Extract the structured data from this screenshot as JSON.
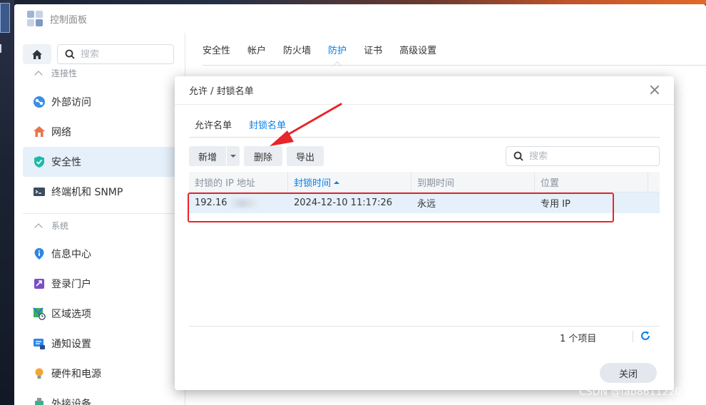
{
  "window": {
    "title": "控制面板"
  },
  "sidebar": {
    "search_placeholder": "搜索",
    "group_connectivity": "连接性",
    "group_system": "系统",
    "items": [
      {
        "label": "外部访问",
        "icon": "external-access-icon"
      },
      {
        "label": "网络",
        "icon": "network-icon"
      },
      {
        "label": "安全性",
        "icon": "security-shield-icon",
        "active": true
      },
      {
        "label": "终端机和 SNMP",
        "icon": "terminal-icon"
      },
      {
        "label": "信息中心",
        "icon": "info-center-icon"
      },
      {
        "label": "登录门户",
        "icon": "login-portal-icon"
      },
      {
        "label": "区域选项",
        "icon": "regional-options-icon"
      },
      {
        "label": "通知设置",
        "icon": "notification-icon"
      },
      {
        "label": "硬件和电源",
        "icon": "hardware-power-icon"
      },
      {
        "label": "外接设备",
        "icon": "external-devices-icon"
      }
    ]
  },
  "tabs": [
    {
      "label": "安全性"
    },
    {
      "label": "帐户"
    },
    {
      "label": "防火墙"
    },
    {
      "label": "防护",
      "active": true
    },
    {
      "label": "证书"
    },
    {
      "label": "高级设置"
    }
  ],
  "dialog": {
    "title": "允许 / 封锁名单",
    "subtabs": [
      {
        "label": "允许名单"
      },
      {
        "label": "封锁名单",
        "active": true
      }
    ],
    "toolbar": {
      "new_label": "新增",
      "delete_label": "删除",
      "export_label": "导出",
      "search_placeholder": "搜索"
    },
    "table": {
      "columns": [
        "封锁的 IP 地址",
        "封锁时间",
        "到期时间",
        "位置"
      ],
      "sorted_column": "封锁时间",
      "rows": [
        {
          "ip": "192.16",
          "blocked_time": "2024-12-10 11:17:26",
          "expiry": "永远",
          "location": "专用 IP"
        }
      ]
    },
    "count_label": "1 个项目",
    "close_label": "关闭"
  },
  "annotation_color": "#e8252a",
  "accent": "#057feb",
  "watermark": "CSDN @fab8611220"
}
